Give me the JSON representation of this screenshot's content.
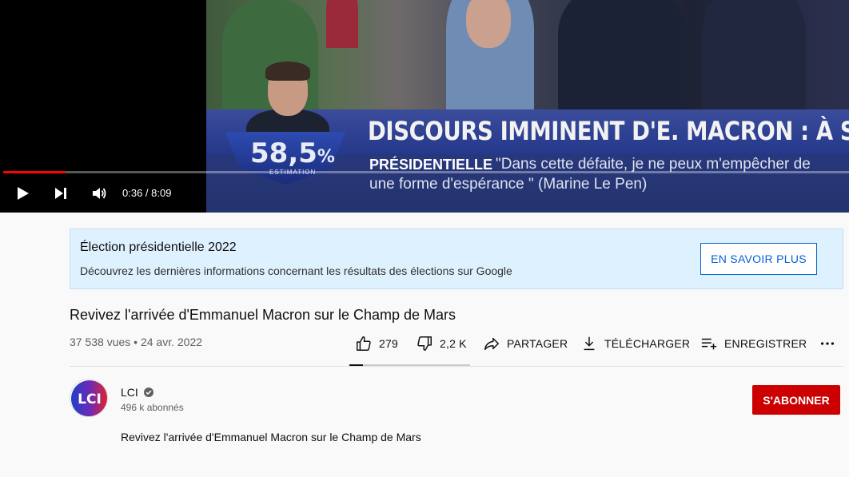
{
  "player": {
    "time_display": "0:36 / 8:09",
    "progress_fraction": 0.074,
    "overlay": {
      "headline": "DISCOURS IMMINENT D'E. MACRON : À SUIVRE",
      "tag": "PRÉSIDENTIELLE",
      "quote_line1": "\"Dans cette défaite, je ne peux m'empêcher de",
      "quote_line2": "une forme d'espérance \" (Marine Le Pen)",
      "percent": "58,5",
      "percent_sign": "%",
      "estimation": "ESTIMATION"
    }
  },
  "banner": {
    "title": "Élection présidentielle 2022",
    "description": "Découvrez les dernières informations concernant les résultats des élections sur Google",
    "button_label": "EN SAVOIR PLUS"
  },
  "video": {
    "title": "Revivez l'arrivée d'Emmanuel Macron sur le Champ de Mars",
    "meta": "37 538 vues • 24 avr. 2022"
  },
  "actions": {
    "like_count": "279",
    "dislike_count": "2,2 K",
    "share_label": "PARTAGER",
    "download_label": "TÉLÉCHARGER",
    "save_label": "ENREGISTRER",
    "like_ratio": 0.11
  },
  "channel": {
    "name": "LCI",
    "logo_text": "LCI",
    "subscribers": "496 k abonnés",
    "subscribe_label": "S'ABONNER"
  },
  "description": {
    "text": "Revivez l'arrivée d'Emmanuel Macron sur le Champ de Mars"
  },
  "colors": {
    "accent_red": "#cc0000",
    "progress_red": "#ff0000",
    "link_blue": "#065fd4",
    "banner_bg": "#def1ff"
  },
  "icons": [
    "play-icon",
    "next-icon",
    "volume-icon",
    "like-icon",
    "dislike-icon",
    "share-icon",
    "download-icon",
    "save-playlist-icon",
    "more-icon",
    "verified-icon"
  ]
}
